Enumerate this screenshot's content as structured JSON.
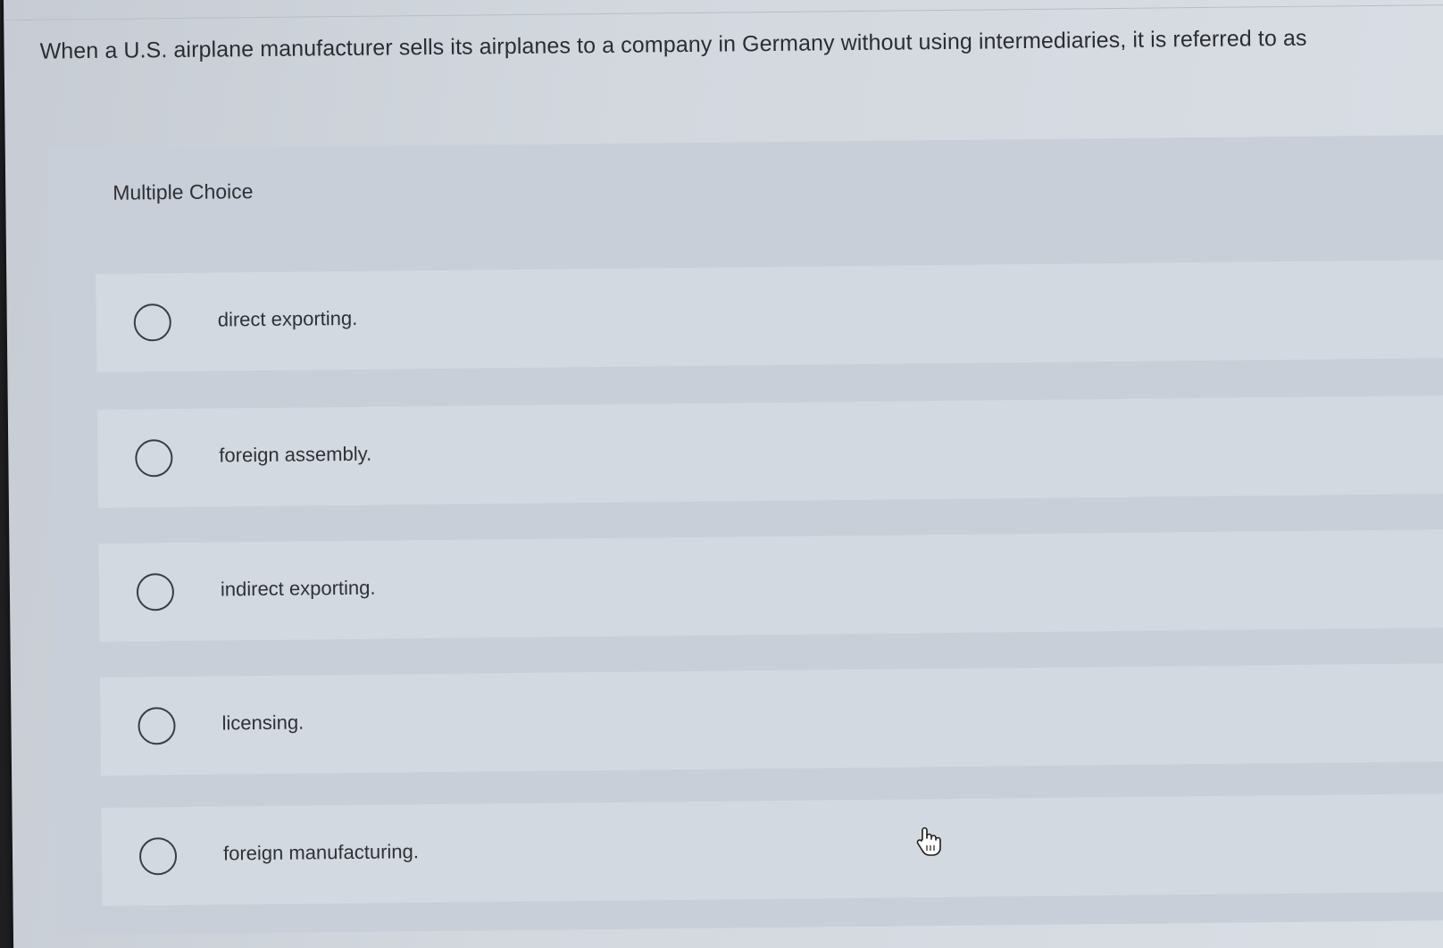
{
  "question": {
    "text": "When a U.S. airplane manufacturer sells its airplanes to a company in Germany without using intermediaries, it is referred to as"
  },
  "multiple_choice": {
    "header": "Multiple Choice",
    "options": [
      {
        "label": "direct exporting.",
        "selected": false
      },
      {
        "label": "foreign assembly.",
        "selected": false
      },
      {
        "label": "indirect exporting.",
        "selected": false
      },
      {
        "label": "licensing.",
        "selected": false
      },
      {
        "label": "foreign manufacturing.",
        "selected": false
      }
    ]
  },
  "cursor": {
    "icon": "hand-pointer-icon"
  },
  "colors": {
    "background": "#d3d8df",
    "panel": "#c9cfd8",
    "option_card": "#d3d9e1",
    "text": "#2b2d31"
  }
}
